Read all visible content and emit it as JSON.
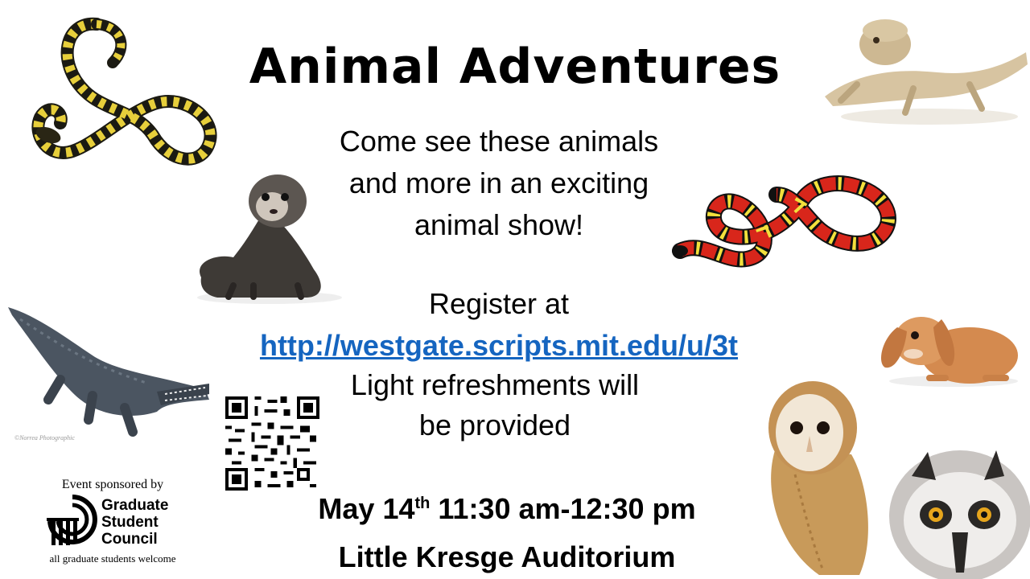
{
  "flyer": {
    "title": "Animal Adventures",
    "intro_lines": [
      "Come see these animals",
      "and more in an exciting",
      "animal show!"
    ],
    "register_label": "Register at",
    "register_url": "http://westgate.scripts.mit.edu/u/3t",
    "refreshments_lines": [
      "Light refreshments will",
      "be provided"
    ],
    "date_month_day": "May 14",
    "date_suffix": "th",
    "date_time": "11:30 am-12:30 pm",
    "venue": "Little Kresge Auditorium"
  },
  "sponsor": {
    "top_text": "Event sponsored by",
    "org_line1": "Graduate",
    "org_line2": "Student",
    "org_line3": "Council",
    "bottom_text": "all graduate students welcome"
  },
  "photo_credit": "©Norrea Photographic",
  "images": [
    "tiger-snake-image",
    "bearded-dragon-image",
    "ferret-image",
    "milk-snake-image",
    "alligator-image",
    "rabbit-image",
    "barn-owl-image",
    "lemur-image",
    "qr-code-image",
    "gsc-logo"
  ]
}
